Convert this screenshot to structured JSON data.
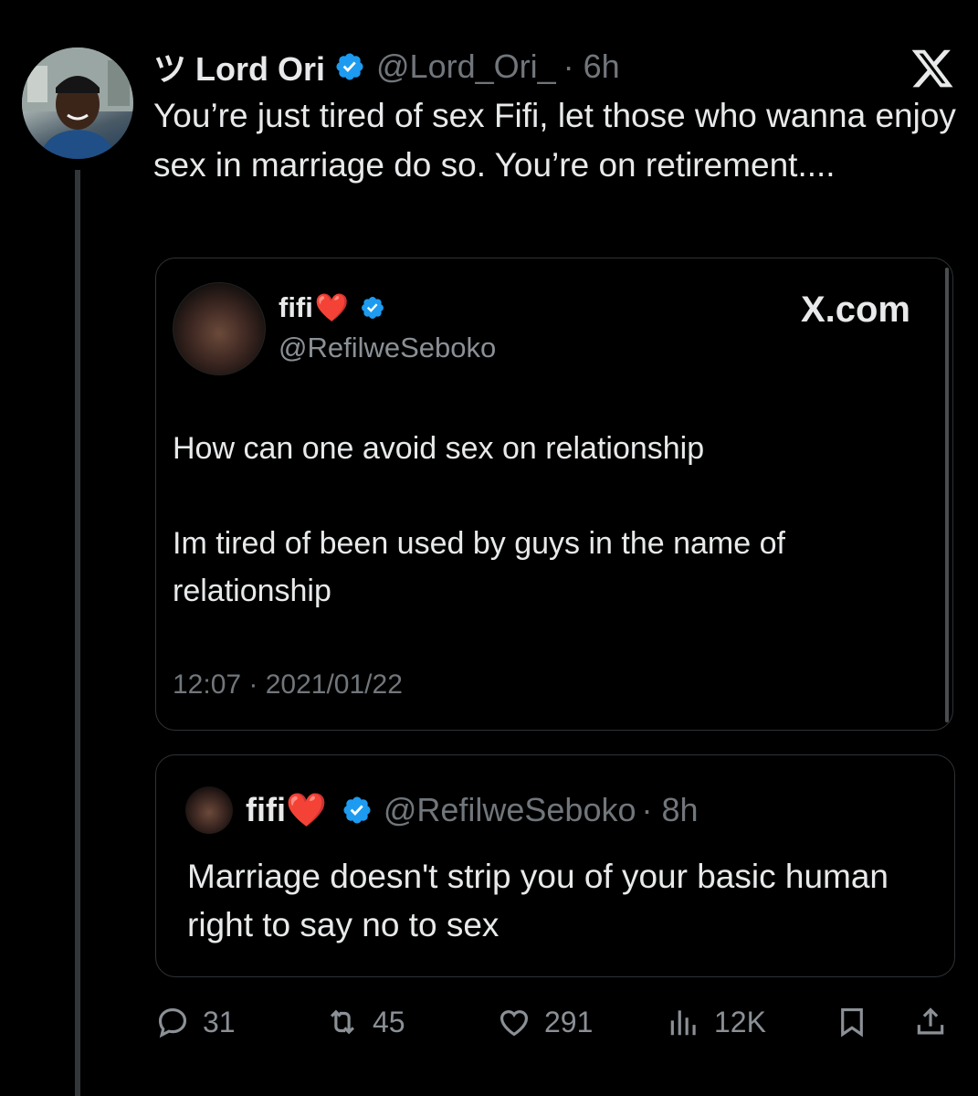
{
  "tweet": {
    "author_name": "ツ Lord Ori",
    "handle": "@Lord_Ori_",
    "time": "· 6h",
    "text": "You’re just tired of sex Fifi, let those who wanna enjoy sex in marriage do so. You’re on retirement...."
  },
  "embedded_card": {
    "name": "fifi",
    "heart": "❤️",
    "handle": "@RefilweSeboko",
    "brand": "X.com",
    "paragraph_1": "How can one avoid sex on relationship",
    "paragraph_2": "Im tired of been  used by guys in the name of relationship",
    "timestamp": "12:07 · 2021/01/22"
  },
  "quoted_tweet": {
    "name": "fifi",
    "heart": "❤️",
    "handle": "@RefilweSeboko",
    "time": "· 8h",
    "text": "Marriage doesn't strip you of your basic human right to say no to sex"
  },
  "actions": {
    "replies": "31",
    "reposts": "45",
    "likes": "291",
    "views": "12K"
  },
  "icons": {
    "verified": "verified-badge-icon",
    "x_logo": "x-logo-icon",
    "reply": "reply-icon",
    "repost": "repost-icon",
    "like": "heart-icon",
    "views": "views-icon",
    "bookmark": "bookmark-icon",
    "share": "share-icon"
  },
  "colors": {
    "background": "#000000",
    "text": "#e7e9ea",
    "muted": "#71767b",
    "verified_blue": "#1d9bf0",
    "heart_red": "#e0202c"
  }
}
